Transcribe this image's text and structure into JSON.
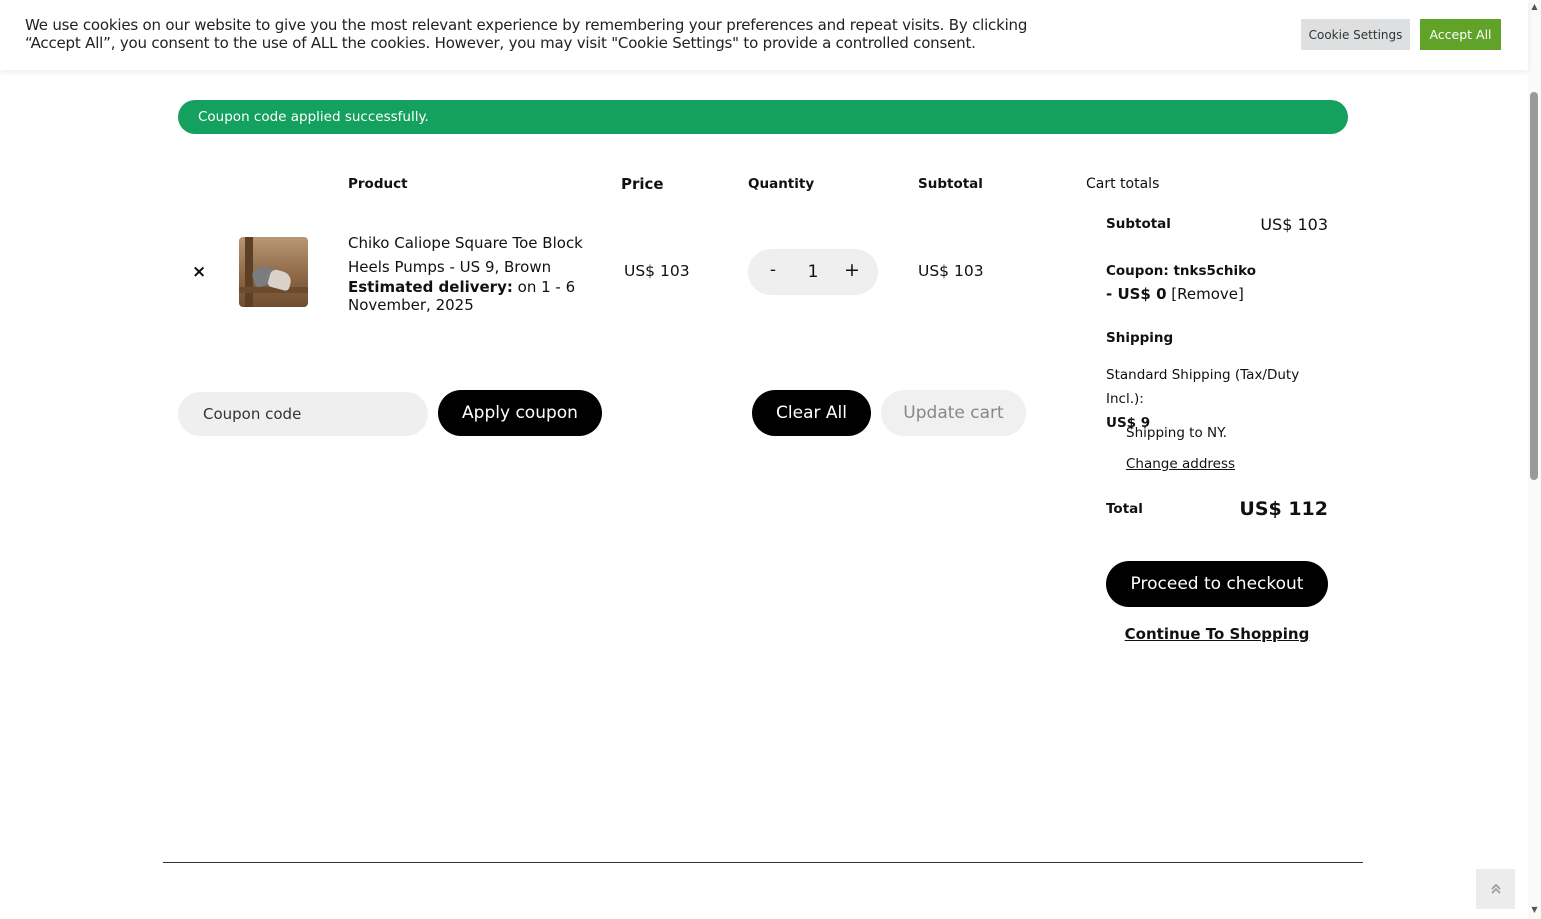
{
  "cookie": {
    "message": "We use cookies on our website to give you the most relevant experience by remembering your preferences and repeat visits. By clicking “Accept All”, you consent to the use of ALL the cookies. However, you may visit \"Cookie Settings\" to provide a controlled consent.",
    "settings_label": "Cookie Settings",
    "accept_label": "Accept All"
  },
  "notice": "Coupon code applied successfully.",
  "table": {
    "headers": {
      "product": "Product",
      "price": "Price",
      "quantity": "Quantity",
      "subtotal": "Subtotal"
    }
  },
  "item": {
    "remove": "×",
    "name": "Chiko Caliope Square Toe Block Heels Pumps - US 9, Brown",
    "delivery_label": "Estimated delivery:",
    "delivery_value": " on 1 - 6 November, 2025",
    "price": "US$ 103",
    "quantity": "1",
    "minus": "-",
    "plus": "+",
    "subtotal": "US$ 103"
  },
  "actions": {
    "coupon_placeholder": "Coupon code",
    "apply_label": "Apply coupon",
    "clear_label": "Clear All",
    "update_label": "Update cart"
  },
  "totals": {
    "title": "Cart totals",
    "subtotal_label": "Subtotal",
    "subtotal_value": "US$ 103",
    "coupon_label": "Coupon: tnks5chiko",
    "coupon_discount": "- US$ 0",
    "coupon_remove": " [Remove]",
    "shipping_label": "Shipping",
    "shipping_method": "Standard Shipping (Tax/Duty Incl.):",
    "shipping_cost": "US$ 9",
    "shipping_to": "Shipping to NY.",
    "change_address": "Change address",
    "total_label": "Total",
    "total_value": "US$ 112",
    "checkout_label": "Proceed to checkout",
    "continue_label": "Continue To Shopping"
  },
  "icons": {
    "back_to_top": "chevrons-up-icon",
    "remove": "close-icon"
  },
  "colors": {
    "accept": "#61a229",
    "notice": "#14a05e",
    "primary_button": "#000000"
  }
}
